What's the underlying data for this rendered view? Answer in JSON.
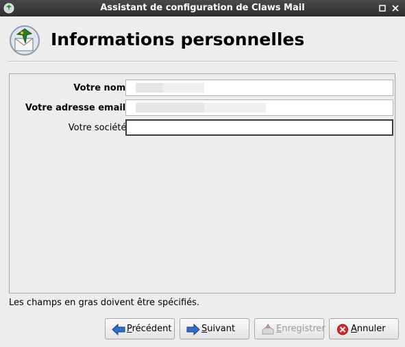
{
  "window": {
    "title": "Assistant de configuration de Claws Mail"
  },
  "header": {
    "title": "Informations personnelles"
  },
  "form": {
    "name": {
      "label": "Votre nom :",
      "value": ""
    },
    "email": {
      "label": "Votre adresse email :",
      "value": ""
    },
    "company": {
      "label": "Votre société :",
      "value": ""
    }
  },
  "note": "Les champs en gras doivent être spécifiés.",
  "buttons": {
    "previous": {
      "mnemonic": "P",
      "rest": "récédent",
      "icon": "arrow-left-icon"
    },
    "next": {
      "mnemonic": "S",
      "rest": "uivant",
      "icon": "arrow-right-icon"
    },
    "save": {
      "mnemonic": "E",
      "rest": "nregistrer",
      "icon": "save-icon"
    },
    "cancel": {
      "mnemonic": "A",
      "rest": "nnuler",
      "icon": "cancel-icon"
    }
  },
  "colors": {
    "titlebar": "#3a3a3a",
    "window": "#ededed",
    "accent": "#2f6fc9",
    "cancel": "#d92b2b"
  }
}
